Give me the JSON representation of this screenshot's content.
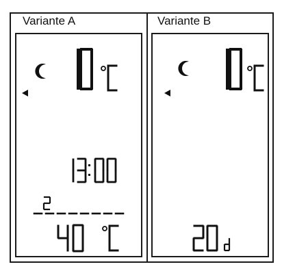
{
  "variants": [
    {
      "title": "Variante A",
      "temperature": "10",
      "temp_unit": "°C",
      "time": "13:00",
      "bar_level": "2",
      "setpoint": "40",
      "setpoint_unit": "°C"
    },
    {
      "title": "Variante B",
      "temperature": "10",
      "temp_unit": "°C",
      "duration": "20",
      "duration_unit": "d"
    }
  ]
}
